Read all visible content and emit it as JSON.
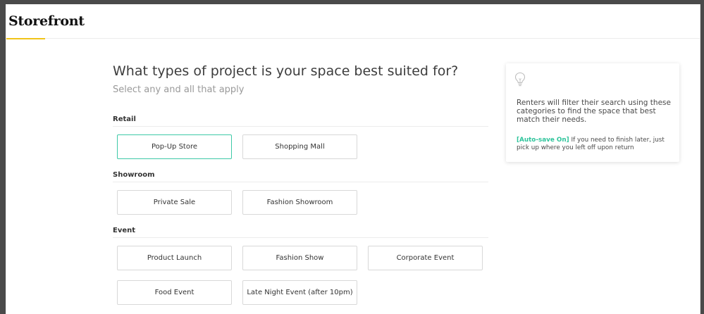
{
  "app": {
    "logo": "Storefront"
  },
  "main": {
    "heading": "What types of project is your space best suited for?",
    "subheading": "Select any and all that apply",
    "sections": [
      {
        "label": "Retail",
        "options": [
          {
            "label": "Pop-Up Store",
            "selected": true
          },
          {
            "label": "Shopping Mall",
            "selected": false
          }
        ]
      },
      {
        "label": "Showroom",
        "options": [
          {
            "label": "Private Sale",
            "selected": false
          },
          {
            "label": "Fashion Showroom",
            "selected": false
          }
        ]
      },
      {
        "label": "Event",
        "options": [
          {
            "label": "Product Launch",
            "selected": false
          },
          {
            "label": "Fashion Show",
            "selected": false
          },
          {
            "label": "Corporate Event",
            "selected": false
          },
          {
            "label": "Food Event",
            "selected": false
          },
          {
            "label": "Late Night Event (after 10pm)",
            "selected": false
          }
        ]
      }
    ]
  },
  "info": {
    "icon": "lightbulb-icon",
    "text": "Renters will filter their search using these categories to find the space that best match their needs.",
    "autosave_tag": "[Auto-save On]",
    "autosave_text": " If you need to finish later, just pick up where you left off upon return"
  },
  "colors": {
    "accent": "#3ec9a7",
    "autosave": "#2ec49b",
    "logo_underline": "#f0c419"
  }
}
